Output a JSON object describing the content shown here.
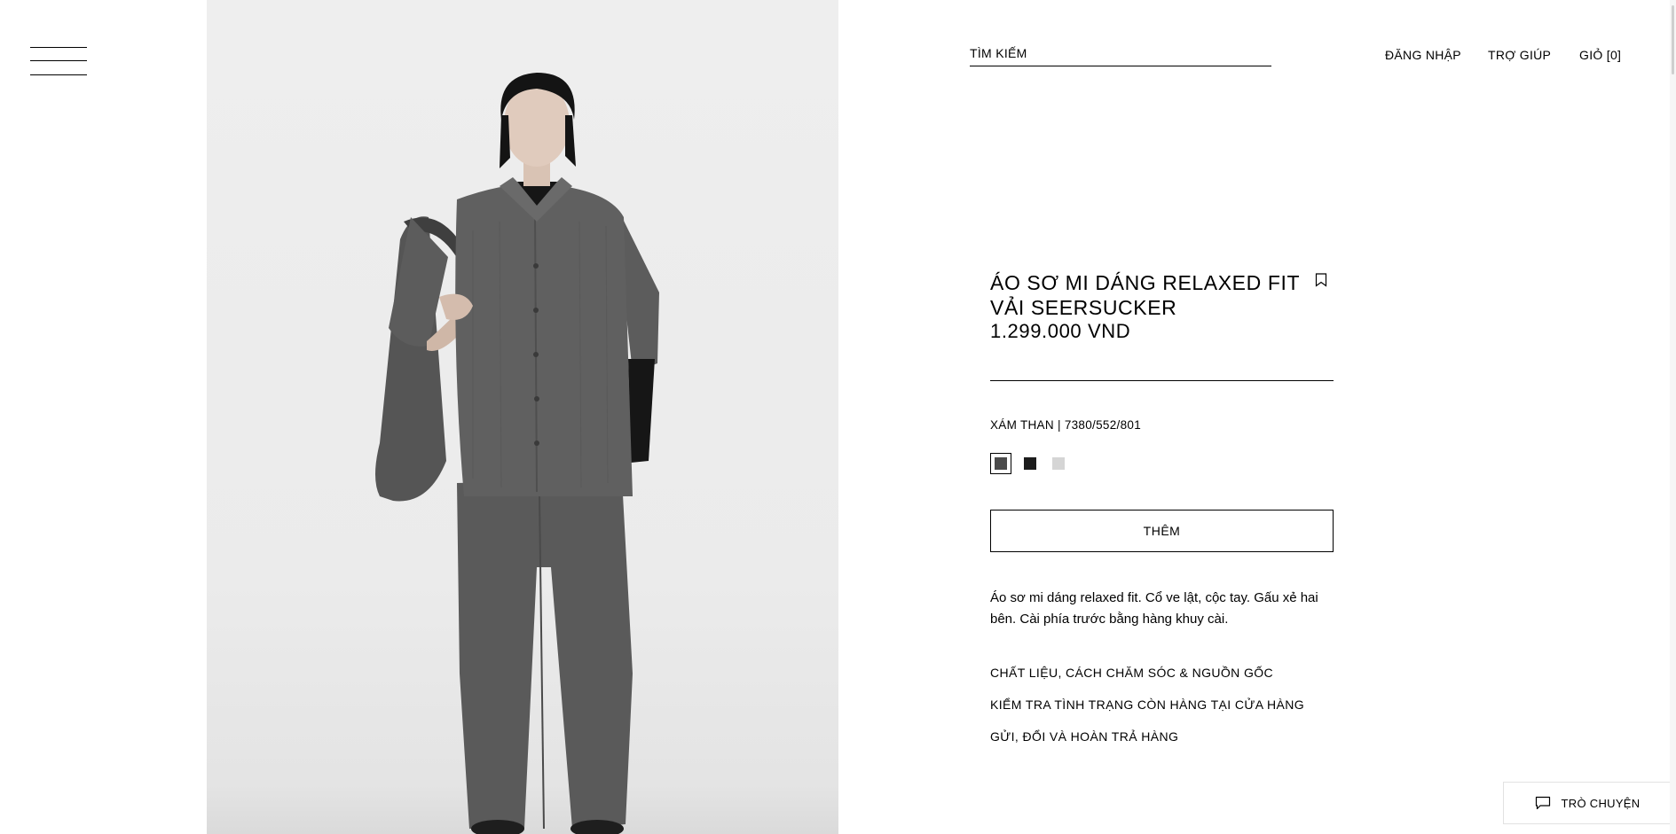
{
  "header": {
    "menu_icon": "hamburger-menu-icon",
    "search_label": "TÌM KIẾM",
    "nav": {
      "login": "ĐĂNG NHẬP",
      "help": "TRỢ GIÚP",
      "cart": "GIỎ [0]"
    }
  },
  "product": {
    "title": "ÁO SƠ MI DÁNG RELAXED FIT VẢI SEERSUCKER",
    "price": "1.299.000 VND",
    "bookmark_icon": "bookmark-icon",
    "color_info": "XÁM THAN | 7380/552/801",
    "swatches": [
      {
        "name": "Xám than",
        "color": "#4b4b4b",
        "selected": true
      },
      {
        "name": "Đen",
        "color": "#1c1c1c",
        "selected": false
      },
      {
        "name": "Xám nhạt",
        "color": "#d5d5d5",
        "selected": false
      }
    ],
    "add_button": "THÊM",
    "description": "Áo sơ mi dáng relaxed fit. Cổ ve lật, cộc tay. Gấu xẻ hai bên. Cài phía trước bằng hàng khuy cài.",
    "sections": [
      "CHẤT LIỆU, CÁCH CHĂM SÓC & NGUỒN GỐC",
      "KIỂM TRA TÌNH TRẠNG CÒN HÀNG TẠI CỬA HÀNG",
      "GỬI, ĐỔI VÀ HOÀN TRẢ HÀNG"
    ]
  },
  "chat": {
    "label": "TRÒ CHUYỆN",
    "icon": "chat-bubble-icon"
  },
  "colors": {
    "text": "#000000",
    "background": "#ffffff",
    "photo_background": "#ececec",
    "garment": "#5e5e5e"
  }
}
